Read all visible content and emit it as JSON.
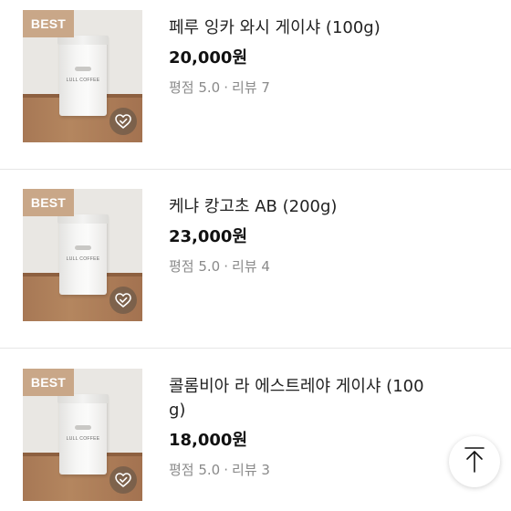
{
  "products": [
    {
      "badge": "BEST",
      "name": "페루 잉카 와시 게이샤 (100g)",
      "price": "20,000원",
      "rating_label": "평점 5.0",
      "separator": "·",
      "review_label": "리뷰 7",
      "bag_brand": "LULL COFFEE"
    },
    {
      "badge": "BEST",
      "name": "케냐 캉고초 AB (200g)",
      "price": "23,000원",
      "rating_label": "평점 5.0",
      "separator": "·",
      "review_label": "리뷰 4",
      "bag_brand": "LULL COFFEE"
    },
    {
      "badge": "BEST",
      "name": "콜롬비아 라 에스트레야 게이샤 (10​0g)",
      "price": "18,000원",
      "rating_label": "평점 5.0",
      "separator": "·",
      "review_label": "리뷰 3",
      "bag_brand": "LULL COFFEE"
    }
  ],
  "icons": {
    "wishlist": "heart-check-icon",
    "scroll_top": "arrow-up-icon"
  },
  "colors": {
    "badge_bg": "#c9a788",
    "price": "#111111",
    "meta": "#8a8a8a",
    "divider": "#e6e6e6"
  }
}
